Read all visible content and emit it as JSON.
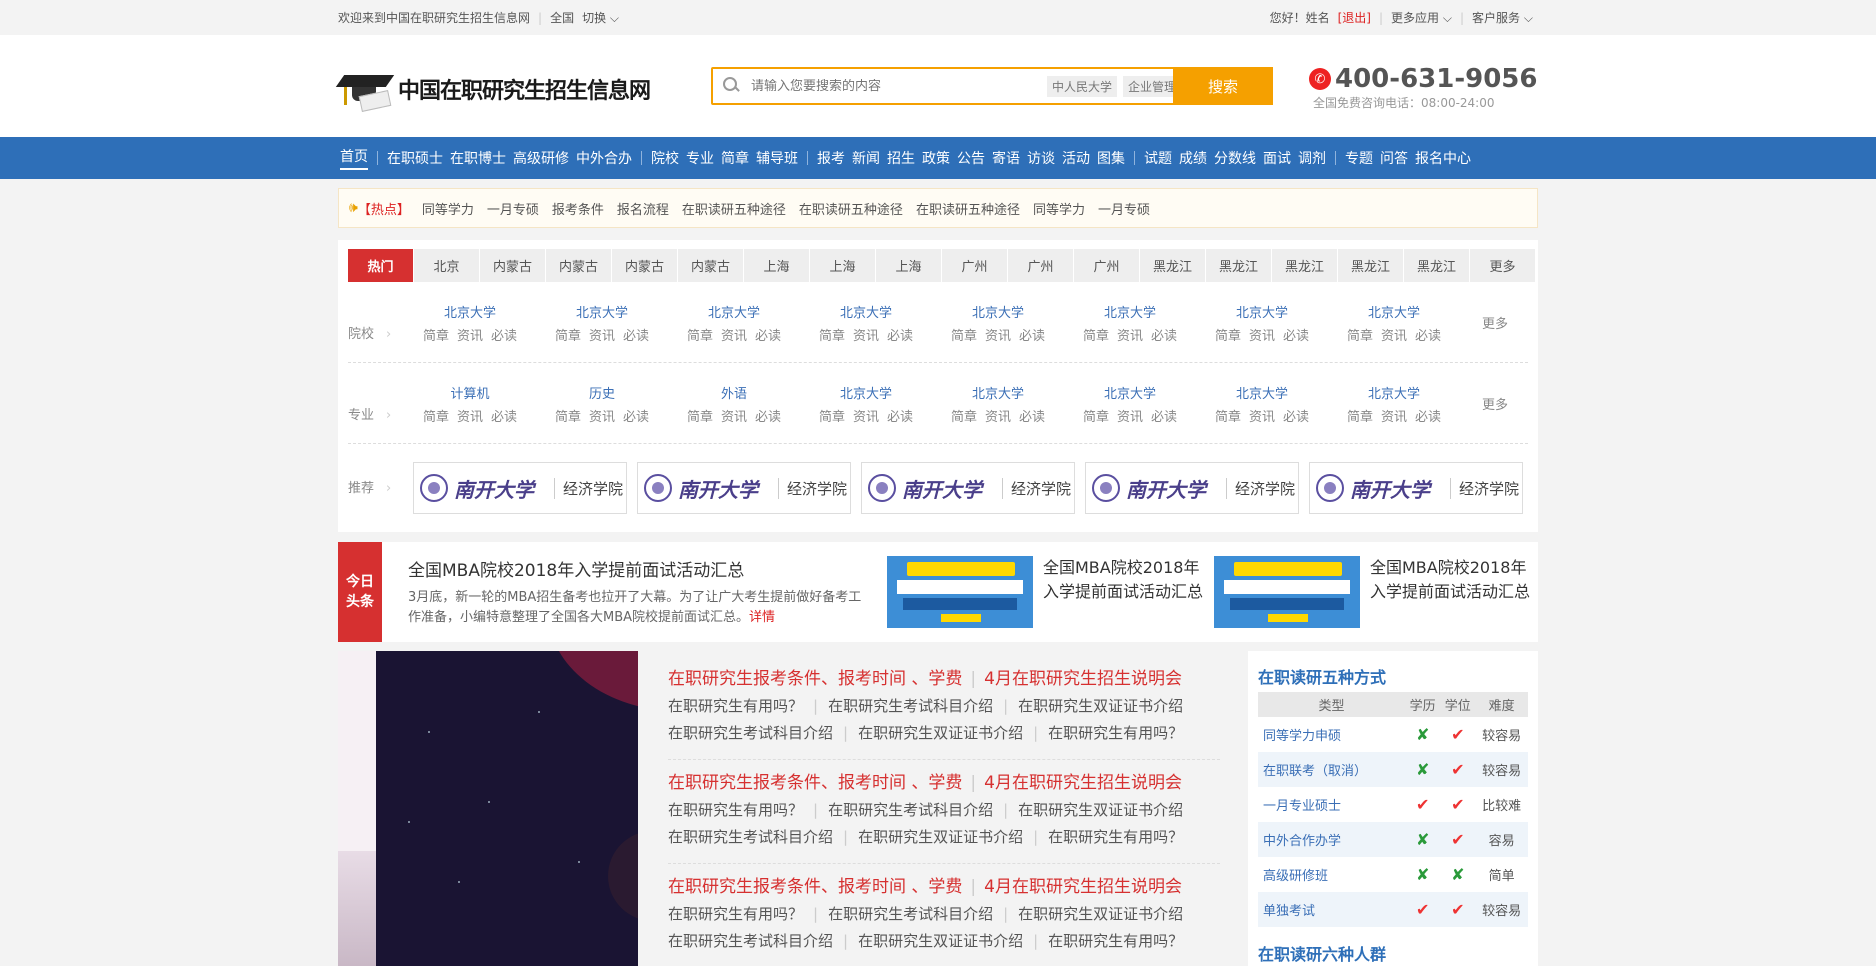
{
  "topbar": {
    "welcome": "欢迎来到中国在职研究生招生信息网",
    "region": "全国",
    "switch": "切换",
    "greeting": "您好！姓名",
    "logout": "[退出]",
    "more_apps": "更多应用",
    "service": "客户服务"
  },
  "header": {
    "site_name": "中国在职研究生招生信息网",
    "search_placeholder": "请输入您要搜索的内容",
    "search_tags": [
      "中人民大学",
      "企业管理"
    ],
    "search_button": "搜索",
    "phone": "400-631-9056",
    "phone_sub": "全国免费咨询电话：08:00-24:00"
  },
  "nav": {
    "groups": [
      [
        "首页"
      ],
      [
        "在职硕士",
        "在职博士",
        "高级研修",
        "中外合办"
      ],
      [
        "院校",
        "专业",
        "简章",
        "辅导班"
      ],
      [
        "报考",
        "新闻",
        "招生",
        "政策",
        "公告",
        "寄语",
        "访谈",
        "活动",
        "图集"
      ],
      [
        "试题",
        "成绩",
        "分数线",
        "面试",
        "调剂"
      ],
      [
        "专题",
        "问答",
        "报名中心"
      ]
    ]
  },
  "hot": {
    "label": "【热点】",
    "items": [
      "同等学力",
      "一月专硕",
      "报考条件",
      "报名流程",
      "在职读研五种途径",
      "在职读研五种途径",
      "在职读研五种途径",
      "同等学力",
      "一月专硕"
    ]
  },
  "filter": {
    "tabs": [
      "热门",
      "北京",
      "内蒙古",
      "内蒙古",
      "内蒙古",
      "内蒙古",
      "上海",
      "上海",
      "上海",
      "广州",
      "广州",
      "广州",
      "黑龙江",
      "黑龙江",
      "黑龙江",
      "黑龙江",
      "黑龙江",
      "更多"
    ],
    "schools_label": "院校",
    "majors_label": "专业",
    "recommend_label": "推荐",
    "more": "更多",
    "sub_links": [
      "简章",
      "资讯",
      "必读"
    ],
    "schools": [
      "北京大学",
      "北京大学",
      "北京大学",
      "北京大学",
      "北京大学",
      "北京大学",
      "北京大学",
      "北京大学"
    ],
    "majors": [
      "计算机",
      "历史",
      "外语",
      "北京大学",
      "北京大学",
      "北京大学",
      "北京大学",
      "北京大学"
    ],
    "recommend_logo": "南开大学",
    "recommend_dept": "经济学院"
  },
  "news": {
    "badge": "今日头条",
    "title": "全国MBA院校2018年入学提前面试活动汇总",
    "desc": "3月底，新一轮的MBA招生备考也拉开了大幕。为了让广大考生提前做好备考工作准备，小编特意整理了全国各大MBA院校提前面试汇总。",
    "more": "详情",
    "side_items": [
      "全国MBA院校2018年入学提前面试活动汇总",
      "全国MBA院校2018年入学提前面试活动汇总"
    ]
  },
  "links": {
    "groups": [
      {
        "head1": "在职研究生报考条件、报考时间 、学费",
        "head2": "4月在职研究生招生说明会",
        "row1": [
          "在职研究生有用吗？",
          "在职研究生考试科目介绍",
          "在职研究生双证证书介绍"
        ],
        "row2": [
          "在职研究生考试科目介绍",
          "在职研究生双证证书介绍",
          "在职研究生有用吗？"
        ]
      },
      {
        "head1": "在职研究生报考条件、报考时间 、学费",
        "head2": "4月在职研究生招生说明会",
        "row1": [
          "在职研究生有用吗？",
          "在职研究生考试科目介绍",
          "在职研究生双证证书介绍"
        ],
        "row2": [
          "在职研究生考试科目介绍",
          "在职研究生双证证书介绍",
          "在职研究生有用吗？"
        ]
      },
      {
        "head1": "在职研究生报考条件、报考时间 、学费",
        "head2": "4月在职研究生招生说明会",
        "row1": [
          "在职研究生有用吗？",
          "在职研究生考试科目介绍",
          "在职研究生双证证书介绍"
        ],
        "row2": [
          "在职研究生考试科目介绍",
          "在职研究生双证证书介绍",
          "在职研究生有用吗？"
        ]
      }
    ]
  },
  "sidebar": {
    "title": "在职读研五种方式",
    "headers": [
      "类型",
      "学历",
      "学位",
      "难度"
    ],
    "rows": [
      {
        "name": "同等学力申硕",
        "edu": "x",
        "degree": "check",
        "level": "较容易"
      },
      {
        "name": "在职联考（取消）",
        "edu": "x",
        "degree": "check",
        "level": "较容易"
      },
      {
        "name": "一月专业硕士",
        "edu": "check",
        "degree": "check",
        "level": "比较难"
      },
      {
        "name": "中外合作办学",
        "edu": "x",
        "degree": "check",
        "level": "容易"
      },
      {
        "name": "高级研修班",
        "edu": "x",
        "degree": "x",
        "level": "简单"
      },
      {
        "name": "单独考试",
        "edu": "check",
        "degree": "check",
        "level": "较容易"
      }
    ],
    "title2": "在职读研六种人群"
  },
  "colors": {
    "brand_blue": "#2e6fb8",
    "accent_red": "#d63030",
    "search_orange": "#f5a000"
  }
}
